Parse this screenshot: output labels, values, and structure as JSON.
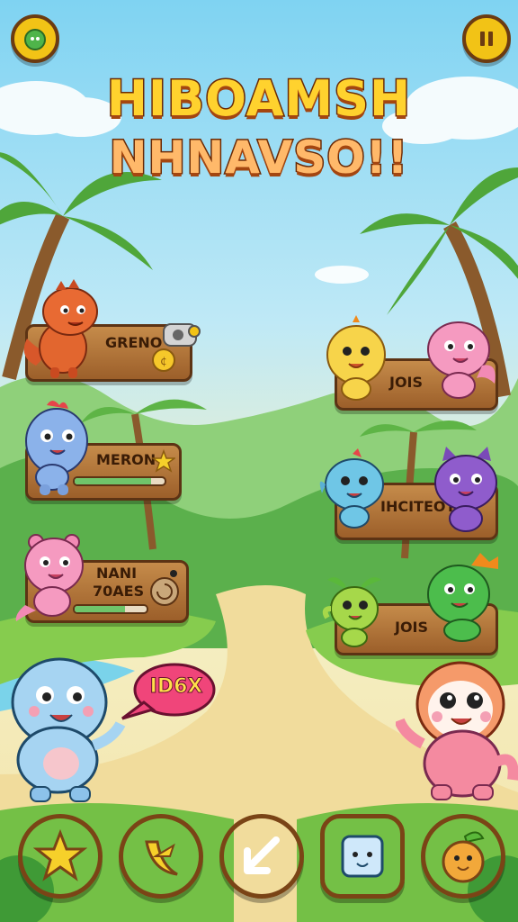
{
  "title": {
    "line1": "HIBOAMSH",
    "line2": "NHNAVSO!!"
  },
  "top_bar": {
    "left_icon": "cat-face-icon",
    "right_icon": "pause-icon"
  },
  "left_creatures": [
    {
      "label": "GRENO",
      "icon": "coin-icon",
      "hp": null
    },
    {
      "label": "MERON",
      "icon": "star-icon",
      "hp": 0.85
    },
    {
      "label_line1": "NANI",
      "label_line2": "70AES",
      "icon": "snail-icon",
      "hp": 0.7
    }
  ],
  "right_creatures": [
    {
      "label": "JOIS"
    },
    {
      "label": "IHCITEOT"
    },
    {
      "label": "JOIS"
    }
  ],
  "speech_bubble": {
    "text": "ID6X"
  },
  "bottom_buttons": [
    {
      "name": "star-button",
      "icon": "star-icon",
      "color": "#6cc43c"
    },
    {
      "name": "banana-button",
      "icon": "banana-icon",
      "color": "#3cc0b0"
    },
    {
      "name": "arrow-button",
      "icon": "arrow-icon",
      "color": "#f08a1c"
    },
    {
      "name": "cube-button",
      "icon": "cube-face-icon",
      "color": "#5aa8e8"
    },
    {
      "name": "fruit-button",
      "icon": "fruit-face-icon",
      "color": "#c8832e"
    }
  ],
  "colors": {
    "wood": "#a8672f",
    "grass": "#7ccf4a",
    "sky": "#7fd3f2",
    "path": "#f3e3a8"
  }
}
